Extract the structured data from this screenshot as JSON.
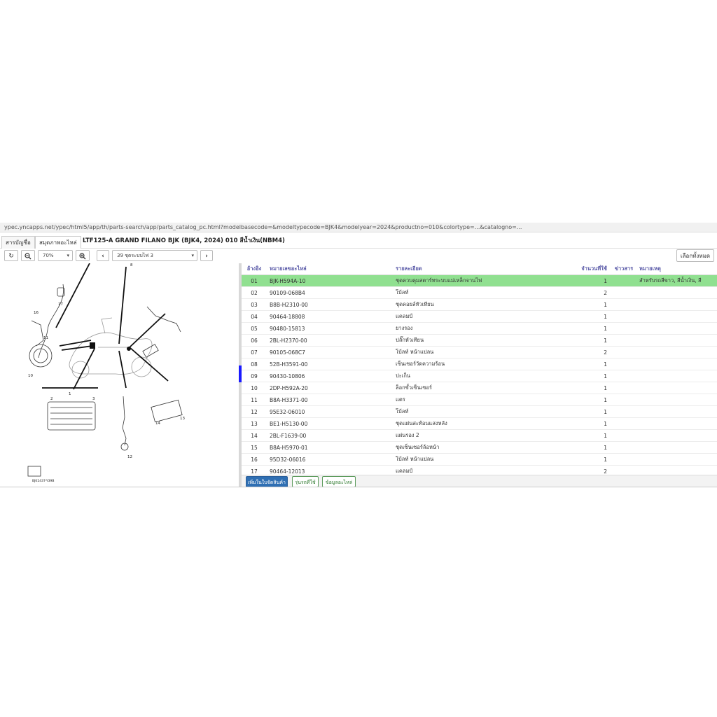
{
  "url": "ypec.yncapps.net/ypec/html5/app/th/parts-search/app/parts_catalog_pc.html?modelbasecode=&modeltypecode=BJK4&modelyear=2024&productno=010&colortype=...&catalogno=...",
  "tabs": [
    {
      "label": "สารบัญชื่อ"
    },
    {
      "label": "สมุดภาพอะไหล่"
    }
  ],
  "model_title": "LTF125-A GRAND FILANO BJK (BJK4, 2024) 010 สีน้ำเงิน(NBM4)",
  "toolbar": {
    "refresh": "↻",
    "zoom_out": "−",
    "zoom_level": "70%",
    "zoom_in": "+",
    "prev": "‹",
    "figure": "39 ชุดระบบไฟ 3",
    "next": "›",
    "select_all": "เลือกทั้งหมด"
  },
  "diagram": {
    "labels": [
      "16",
      "17",
      "11",
      "10",
      "1",
      "2",
      "3",
      "12",
      "13",
      "14",
      "8"
    ],
    "caption": "BJK1437-Y39B"
  },
  "table": {
    "headers": {
      "ref": "อ้างอิง",
      "part_no": "หมายเลขอะไหล่",
      "desc": "รายละเอียด",
      "qty": "จำนวนที่ใช้",
      "news": "ข่าวสาร",
      "remark": "หมายเหตุ"
    },
    "rows": [
      {
        "ref": "01",
        "part_no": "BJK-H594A-10",
        "desc": "ชุดควบคุมสตาร์ทระบบแม่เหล็กจานไฟ",
        "qty": "1",
        "remark": "สำหรับรถสีขาว, สีน้ำเงิน, สี"
      },
      {
        "ref": "02",
        "part_no": "90109-068B4",
        "desc": "โบ้ลท์",
        "qty": "2",
        "remark": ""
      },
      {
        "ref": "03",
        "part_no": "B8B-H2310-00",
        "desc": "ชุดคอยล์หัวเทียน",
        "qty": "1",
        "remark": ""
      },
      {
        "ref": "04",
        "part_no": "90464-18808",
        "desc": "แคลมป์",
        "qty": "1",
        "remark": ""
      },
      {
        "ref": "05",
        "part_no": "90480-15813",
        "desc": "ยางรอง",
        "qty": "1",
        "remark": ""
      },
      {
        "ref": "06",
        "part_no": "2BL-H2370-00",
        "desc": "ปลั๊กหัวเทียน",
        "qty": "1",
        "remark": ""
      },
      {
        "ref": "07",
        "part_no": "90105-068C7",
        "desc": "โบ้ลท์ หน้าแปลน",
        "qty": "2",
        "remark": ""
      },
      {
        "ref": "08",
        "part_no": "52B-H3591-00",
        "desc": "เซ็นเซอร์วัดความร้อน",
        "qty": "1",
        "remark": ""
      },
      {
        "ref": "09",
        "part_no": "90430-10806",
        "desc": "ปะเก็น",
        "qty": "1",
        "remark": ""
      },
      {
        "ref": "10",
        "part_no": "2DP-H592A-20",
        "desc": "ล็อกขั้วเซ็นเซอร์",
        "qty": "1",
        "remark": ""
      },
      {
        "ref": "11",
        "part_no": "B8A-H3371-00",
        "desc": "แตร",
        "qty": "1",
        "remark": ""
      },
      {
        "ref": "12",
        "part_no": "95E32-06010",
        "desc": "โบ้ลท์",
        "qty": "1",
        "remark": ""
      },
      {
        "ref": "13",
        "part_no": "BE1-H5130-00",
        "desc": "ชุดแผ่นสะท้อนแสงหลัง",
        "qty": "1",
        "remark": ""
      },
      {
        "ref": "14",
        "part_no": "2BL-F1639-00",
        "desc": "แผ่นรอง 2",
        "qty": "1",
        "remark": ""
      },
      {
        "ref": "15",
        "part_no": "B8A-H5970-01",
        "desc": "ชุดเซ็นเซอร์ล้อหน้า",
        "qty": "1",
        "remark": ""
      },
      {
        "ref": "16",
        "part_no": "95D32-06016",
        "desc": "โบ้ลท์ หน้าแปลน",
        "qty": "1",
        "remark": ""
      },
      {
        "ref": "17",
        "part_no": "90464-12013",
        "desc": "แคลมป์",
        "qty": "2",
        "remark": ""
      }
    ],
    "selected_index": 0
  },
  "bottom": {
    "add_to_cart": "เพิ่มในใบจัดสินค้า",
    "where_used": "รุ่นรถที่ใช้",
    "part_info": "ข้อมูลอะไหล่"
  },
  "colors": {
    "selected_row": "#90e090",
    "header_text": "#5a5aa8",
    "primary_button": "#2f6fb3",
    "accent_strip": "#1a1aff"
  }
}
